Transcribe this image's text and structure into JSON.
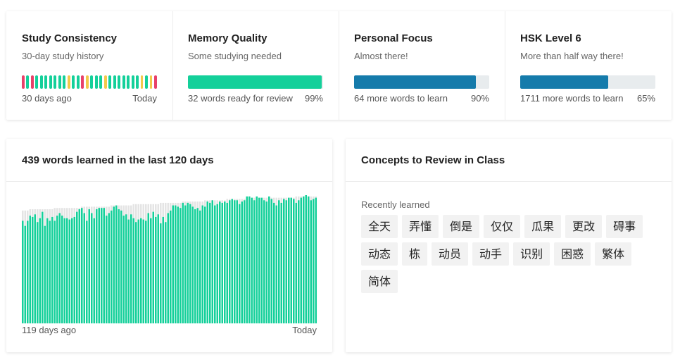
{
  "stats": [
    {
      "title": "Study Consistency",
      "subtitle": "30-day study history",
      "foot_left": "30 days ago",
      "foot_right": "Today"
    },
    {
      "title": "Memory Quality",
      "subtitle": "Some studying needed",
      "foot_left": "32 words ready for review",
      "foot_right": "99%",
      "progress": 0.99,
      "color": "#14d09a"
    },
    {
      "title": "Personal Focus",
      "subtitle": "Almost there!",
      "foot_left": "64 more words to learn",
      "foot_right": "90%",
      "progress": 0.9,
      "color": "#157bab"
    },
    {
      "title": "HSK Level 6",
      "subtitle": "More than half way there!",
      "foot_left": "1711 more words to learn",
      "foot_right": "65%",
      "progress": 0.65,
      "color": "#157bab"
    }
  ],
  "streak_colors": {
    "red": "#e8416a",
    "green": "#14d09a",
    "yellow": "#f3c94a"
  },
  "streak": [
    "red",
    "green",
    "red",
    "green",
    "green",
    "green",
    "green",
    "green",
    "green",
    "green",
    "yellow",
    "green",
    "green",
    "red",
    "yellow",
    "green",
    "green",
    "green",
    "yellow",
    "green",
    "green",
    "green",
    "green",
    "green",
    "green",
    "green",
    "yellow",
    "green",
    "yellow",
    "red"
  ],
  "words_panel": {
    "title": "439 words learned in the last 120 days",
    "axis_left": "119 days ago",
    "axis_right": "Today"
  },
  "chart_data": {
    "type": "bar",
    "title": "439 words learned in the last 120 days",
    "x_start_label": "119 days ago",
    "x_end_label": "Today",
    "ylim": [
      0,
      100
    ],
    "series": [
      {
        "color": "#14d09a",
        "values": [
          80,
          76,
          80,
          84,
          83,
          85,
          79,
          82,
          87,
          76,
          82,
          80,
          83,
          80,
          84,
          86,
          84,
          82,
          82,
          81,
          82,
          83,
          87,
          89,
          90,
          86,
          80,
          89,
          86,
          82,
          89,
          90,
          90,
          90,
          84,
          86,
          88,
          91,
          92,
          89,
          88,
          84,
          85,
          81,
          85,
          82,
          79,
          81,
          82,
          81,
          80,
          86,
          82,
          87,
          83,
          85,
          78,
          83,
          79,
          86,
          88,
          92,
          92,
          91,
          90,
          94,
          92,
          94,
          93,
          91,
          89,
          90,
          88,
          92,
          91,
          95,
          94,
          96,
          92,
          93,
          95,
          94,
          95,
          94,
          96,
          97,
          96,
          96,
          93,
          95,
          96,
          99,
          99,
          98,
          96,
          99,
          98,
          98,
          96,
          95,
          99,
          97,
          94,
          92,
          96,
          94,
          97,
          96,
          98,
          98,
          97,
          94,
          96,
          98,
          99,
          101,
          99,
          96,
          97,
          98
        ]
      },
      {
        "color": "#e4e4e4",
        "values": [
          88,
          88,
          88,
          89,
          89,
          89,
          89,
          89,
          89,
          89,
          89,
          89,
          89,
          90,
          90,
          90,
          90,
          90,
          90,
          90,
          90,
          90,
          90,
          90,
          91,
          91,
          91,
          91,
          91,
          91,
          91,
          91,
          91,
          91,
          91,
          91,
          92,
          92,
          92,
          92,
          92,
          92,
          92,
          92,
          92,
          93,
          93,
          93,
          93,
          93,
          93,
          93,
          93,
          93,
          93,
          93,
          94,
          94,
          94,
          94,
          94,
          94,
          94,
          94,
          94,
          95,
          95,
          95,
          95,
          95,
          95,
          95,
          95,
          95,
          96,
          96,
          96,
          96,
          96,
          96,
          96,
          96,
          96,
          97,
          97,
          97,
          97,
          97,
          97,
          97,
          97,
          97,
          98,
          98,
          98,
          98,
          98,
          98,
          98,
          98,
          98,
          98,
          98,
          98,
          98,
          98,
          98,
          98,
          98,
          98,
          98,
          99,
          99,
          99,
          99,
          101,
          99,
          99,
          99,
          99
        ]
      }
    ]
  },
  "concepts_panel": {
    "title": "Concepts to Review in Class",
    "recent_label": "Recently learned"
  },
  "concepts": [
    "全天",
    "弄懂",
    "倒是",
    "仅仅",
    "瓜果",
    "更改",
    "碍事",
    "动态",
    "栋",
    "动员",
    "动手",
    "识别",
    "困惑",
    "繁体",
    "简体"
  ]
}
